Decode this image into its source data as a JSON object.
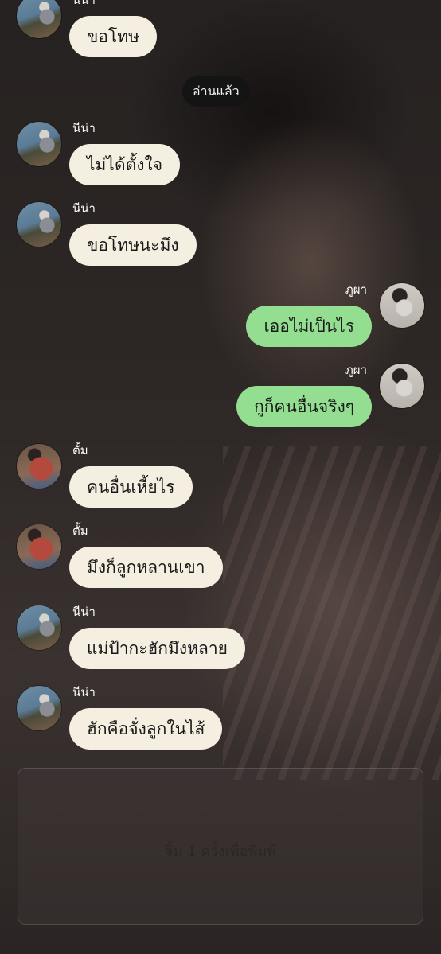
{
  "read_receipt": "อ่านแล้ว",
  "messages": [
    {
      "sender": "นีน่า",
      "text": "ขอโทษ",
      "side": "in",
      "avatar": "nina-avatar"
    },
    {
      "sender": "นีน่า",
      "text": "ไม่ได้ตั้งใจ",
      "side": "in",
      "avatar": "nina-avatar"
    },
    {
      "sender": "นีน่า",
      "text": "ขอโทษนะมึง",
      "side": "in",
      "avatar": "nina-avatar"
    },
    {
      "sender": "ภูผา",
      "text": "เออไม่เป็นไร",
      "side": "out",
      "avatar": "phupha-avatar"
    },
    {
      "sender": "ภูผา",
      "text": "กูก็คนอื่นจริงๆ",
      "side": "out",
      "avatar": "phupha-avatar"
    },
    {
      "sender": "ตั้ม",
      "text": "คนอื่นเหี้ยไร",
      "side": "in",
      "avatar": "tom-avatar"
    },
    {
      "sender": "ตั้ม",
      "text": "มึงก็ลูกหลานเขา",
      "side": "in",
      "avatar": "tom-avatar"
    },
    {
      "sender": "นีน่า",
      "text": "แม่ป้ากะฮักมึงหลาย",
      "side": "in",
      "avatar": "nina-avatar"
    },
    {
      "sender": "นีน่า",
      "text": "ฮักคือจั่งลูกในไส้",
      "side": "in",
      "avatar": "nina-avatar"
    }
  ],
  "input": {
    "placeholder": "จิ้ม 1 ครั้งเพื่อพิมพ์"
  },
  "colors": {
    "incoming_bubble": "#f5efe2",
    "outgoing_bubble": "#93de90",
    "read_badge": "#141414"
  }
}
